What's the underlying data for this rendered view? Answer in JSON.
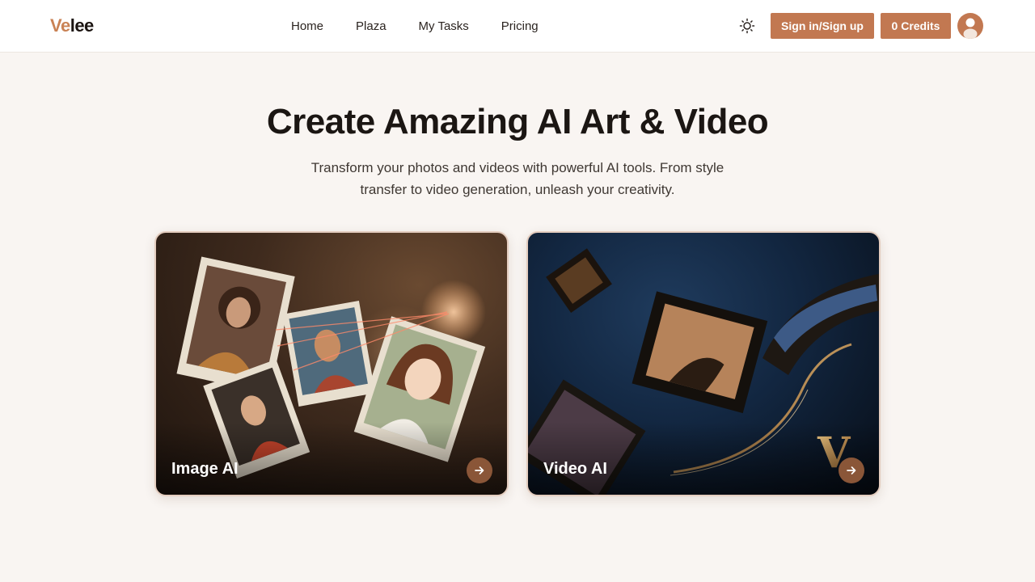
{
  "header": {
    "logo_prefix": "Ve",
    "logo_suffix": "lee",
    "nav": [
      {
        "label": "Home"
      },
      {
        "label": "Plaza"
      },
      {
        "label": "My Tasks"
      },
      {
        "label": "Pricing"
      }
    ],
    "theme_icon": "sun-icon",
    "signin_label": "Sign in/Sign up",
    "credits_label": "0 Credits",
    "avatar_icon": "user-icon"
  },
  "hero": {
    "title": "Create Amazing AI Art & Video",
    "subtitle": "Transform your photos and videos with powerful AI tools. From style transfer to video generation, unleash your creativity."
  },
  "cards": [
    {
      "label": "Image AI",
      "icon": "arrow-right-icon"
    },
    {
      "label": "Video AI",
      "icon": "arrow-right-icon"
    }
  ],
  "colors": {
    "accent": "#c27851",
    "logo_accent": "#c98255",
    "background": "#f9f5f2",
    "card_arrow": "#8a5638"
  }
}
